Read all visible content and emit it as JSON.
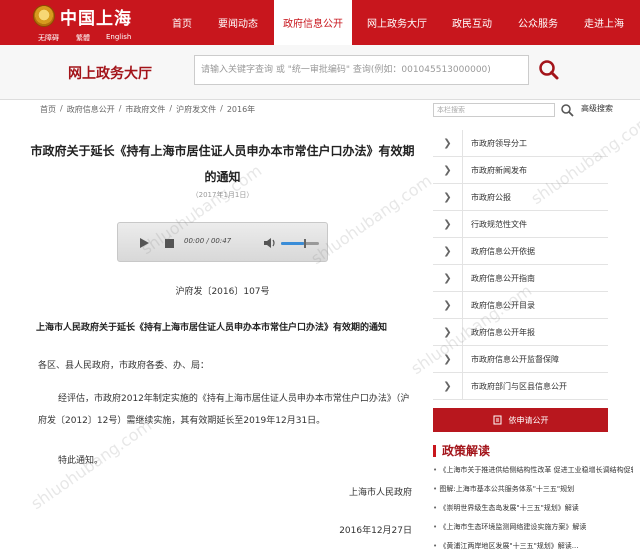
{
  "top_nav": {
    "logo_title": "中国上海",
    "logo_links": [
      "无障碍",
      "繁體",
      "English"
    ],
    "items": [
      {
        "label": "首页",
        "active": false
      },
      {
        "label": "要闻动态",
        "active": false
      },
      {
        "label": "政府信息公开",
        "active": true
      },
      {
        "label": "网上政务大厅",
        "active": false
      },
      {
        "label": "政民互动",
        "active": false
      },
      {
        "label": "公众服务",
        "active": false
      },
      {
        "label": "走进上海",
        "active": false
      }
    ]
  },
  "header": {
    "service_title": "网上政务大厅",
    "search_placeholder": "请输入关键字查询 或 \"统一审批编码\" 查询(例如：001045513000000)"
  },
  "breadcrumb": [
    "首页",
    "/",
    "政府信息公开",
    "/",
    "市政府文件",
    "/",
    "沪府发文件",
    "/",
    "2016年"
  ],
  "article": {
    "title": "市政府关于延长《持有上海市居住证人员申办本市常住户口办法》有效期的通知",
    "date": "（2017年1月1日）",
    "player": {
      "time": "00:00 / 00:47",
      "volume_fraction": 0.6
    },
    "doc_number": "沪府发〔2016〕107号",
    "paragraph_title": "上海市人民政府关于延长《持有上海市居住证人员申办本市常住户口办法》有效期的通知",
    "salutation": "各区、县人民政府，市政府各委、办、局：",
    "body": "经评估，市政府2012年制定实施的《持有上海市居住证人员申办本市常住户口办法》（沪府发〔2012〕12号）需继续实施，其有效期延长至2019年12月31日。",
    "closing": "特此通知。",
    "signature": "上海市人民政府",
    "sign_date": "2016年12月27日"
  },
  "sidebar": {
    "search_placeholder": "本栏搜索",
    "advanced_search": "高级搜索",
    "items": [
      "市政府领导分工",
      "市政府新闻发布",
      "市政府公报",
      "行政规范性文件",
      "政府信息公开依据",
      "政府信息公开指南",
      "政府信息公开目录",
      "政府信息公开年报",
      "市政府信息公开监督保障",
      "市政府部门与区县信息公开"
    ],
    "apply_button": "依申请公开",
    "policy_heading": "政策解读",
    "policy_items": [
      "《上海市关于推进供给侧结构性改革 促进工业稳增长调结构促转型的实施意见》一致性评...",
      "图解:上海市基本公共服务体系\"十三五\"规划",
      "《崇明世界级生态岛发展\"十三五\"规划》解读",
      "《上海市生态环境监测网络建设实施方案》解读",
      "《黄浦江两岸地区发展\"十三五\"规划》解读..."
    ]
  },
  "watermark": "shluohubang.com",
  "colors": {
    "primary_red": "#c8161d",
    "dark_red": "#a3141a"
  }
}
